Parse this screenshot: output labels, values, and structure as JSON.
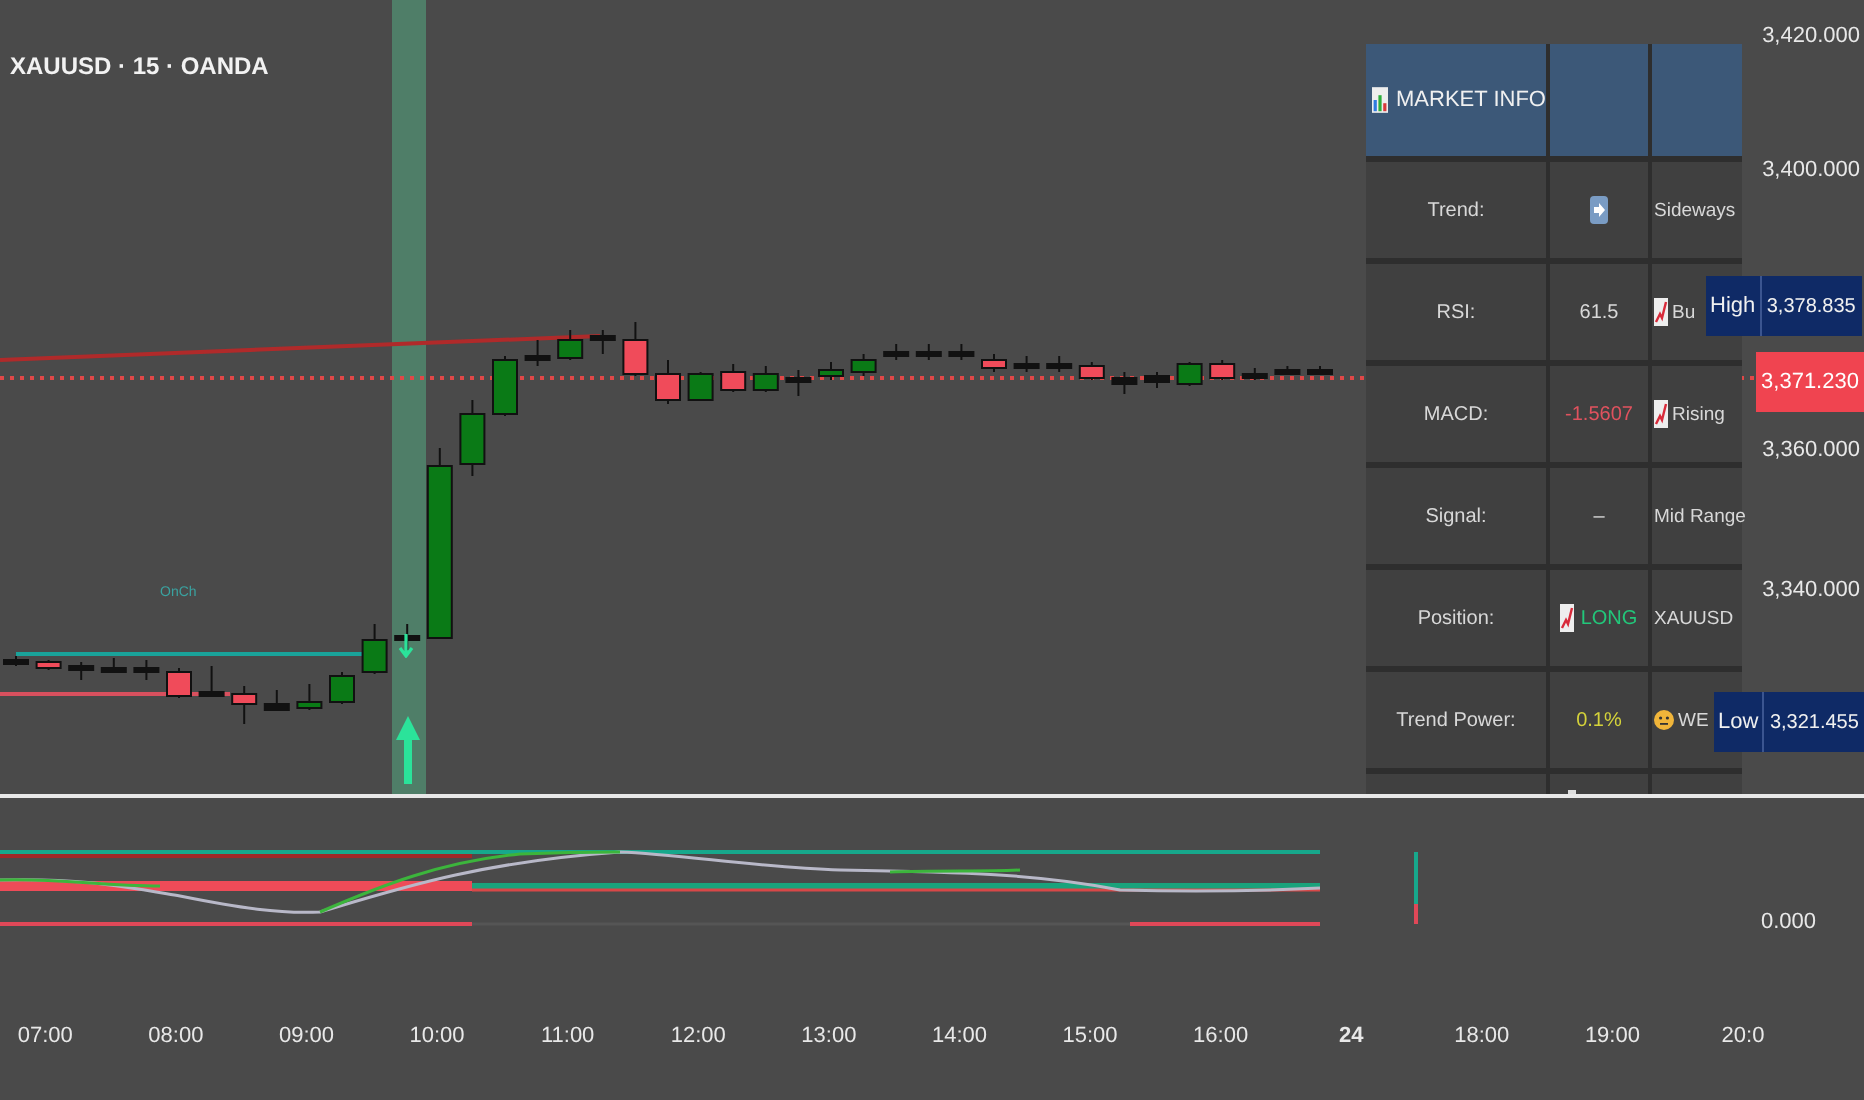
{
  "symbol_title": "XAUUSD · 15 · OANDA",
  "signal_label": "OnCh",
  "price_axis": {
    "ticks": [
      "3,420.000",
      "3,400.000",
      "3,360.000",
      "3,340.000"
    ],
    "high": {
      "label": "High",
      "value": "3,378.835"
    },
    "current": {
      "value": "3,371.230"
    },
    "low": {
      "label": "Low",
      "value": "3,321.455"
    }
  },
  "market_info": {
    "title": "MARKET INFO",
    "rows": [
      {
        "label": "Trend:",
        "value": {
          "icon": {
            "kind": "arrow"
          }
        },
        "status": {
          "text": "Sideways"
        }
      },
      {
        "label": "RSI:",
        "value": {
          "text": "61.5"
        },
        "status": {
          "icon": {
            "kind": "chart"
          },
          "text": "Bu"
        }
      },
      {
        "label": "MACD:",
        "value": {
          "text": "-1.5607",
          "color": "#e0525e"
        },
        "status": {
          "icon": {
            "kind": "chart"
          },
          "text": "Rising"
        }
      },
      {
        "label": "Signal:",
        "value": {
          "text": "–"
        },
        "status": {
          "text": "Mid Range"
        }
      },
      {
        "label": "Position:",
        "value": {
          "icon": {
            "kind": "chart"
          },
          "text": "LONG",
          "color": "#22c77a"
        },
        "status": {
          "text": "XAUUSD"
        }
      },
      {
        "label": "Trend Power:",
        "value": {
          "text": "0.1%",
          "color": "#d4d23a"
        },
        "status": {
          "icon": {
            "kind": "face"
          },
          "text": "WE"
        }
      }
    ]
  },
  "indicator_axis": {
    "tick": "0.000"
  },
  "time_axis": [
    {
      "label": "07:00",
      "bold": false
    },
    {
      "label": "08:00",
      "bold": false
    },
    {
      "label": "09:00",
      "bold": false
    },
    {
      "label": "10:00",
      "bold": false
    },
    {
      "label": "11:00",
      "bold": false
    },
    {
      "label": "12:00",
      "bold": false
    },
    {
      "label": "13:00",
      "bold": false
    },
    {
      "label": "14:00",
      "bold": false
    },
    {
      "label": "15:00",
      "bold": false
    },
    {
      "label": "16:00",
      "bold": false
    },
    {
      "label": "24",
      "bold": true
    },
    {
      "label": "18:00",
      "bold": false
    },
    {
      "label": "19:00",
      "bold": false
    },
    {
      "label": "20:0",
      "bold": false
    }
  ]
}
